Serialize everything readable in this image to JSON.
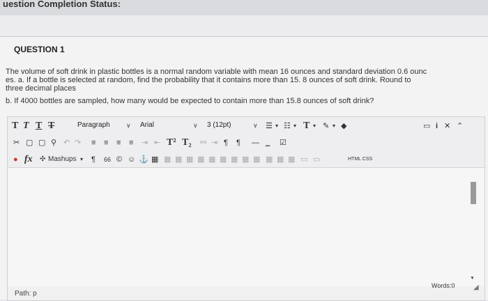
{
  "status": {
    "label": "uestion Completion Status:"
  },
  "question": {
    "title": "QUESTION 1",
    "line1": "The volume of soft drink in plastic bottles is a normal random variable with mean 16 ounces and standard deviation 0.6 ounc",
    "line2": "es. a. If a bottle is selected at random, find the probability that it contains more than 15. 8 ounces of soft drink. Round to",
    "line3": "three decimal places",
    "line4": "b. If 4000 bottles are sampled, how many would be expected to contain more than 15.8 ounces of soft drink?"
  },
  "editor": {
    "toolbar1": {
      "bold": "T",
      "italic": "T",
      "underline": "T",
      "strike": "T",
      "paragraph": "Paragraph",
      "font": "Arial",
      "size": "3 (12pt)"
    },
    "toolbar3": {
      "mashups": "Mashups",
      "pilcrow": "¶",
      "quote": "66",
      "html_css": "HTML CSS"
    },
    "path_label": "Path: p",
    "words_label": "Words:0"
  }
}
